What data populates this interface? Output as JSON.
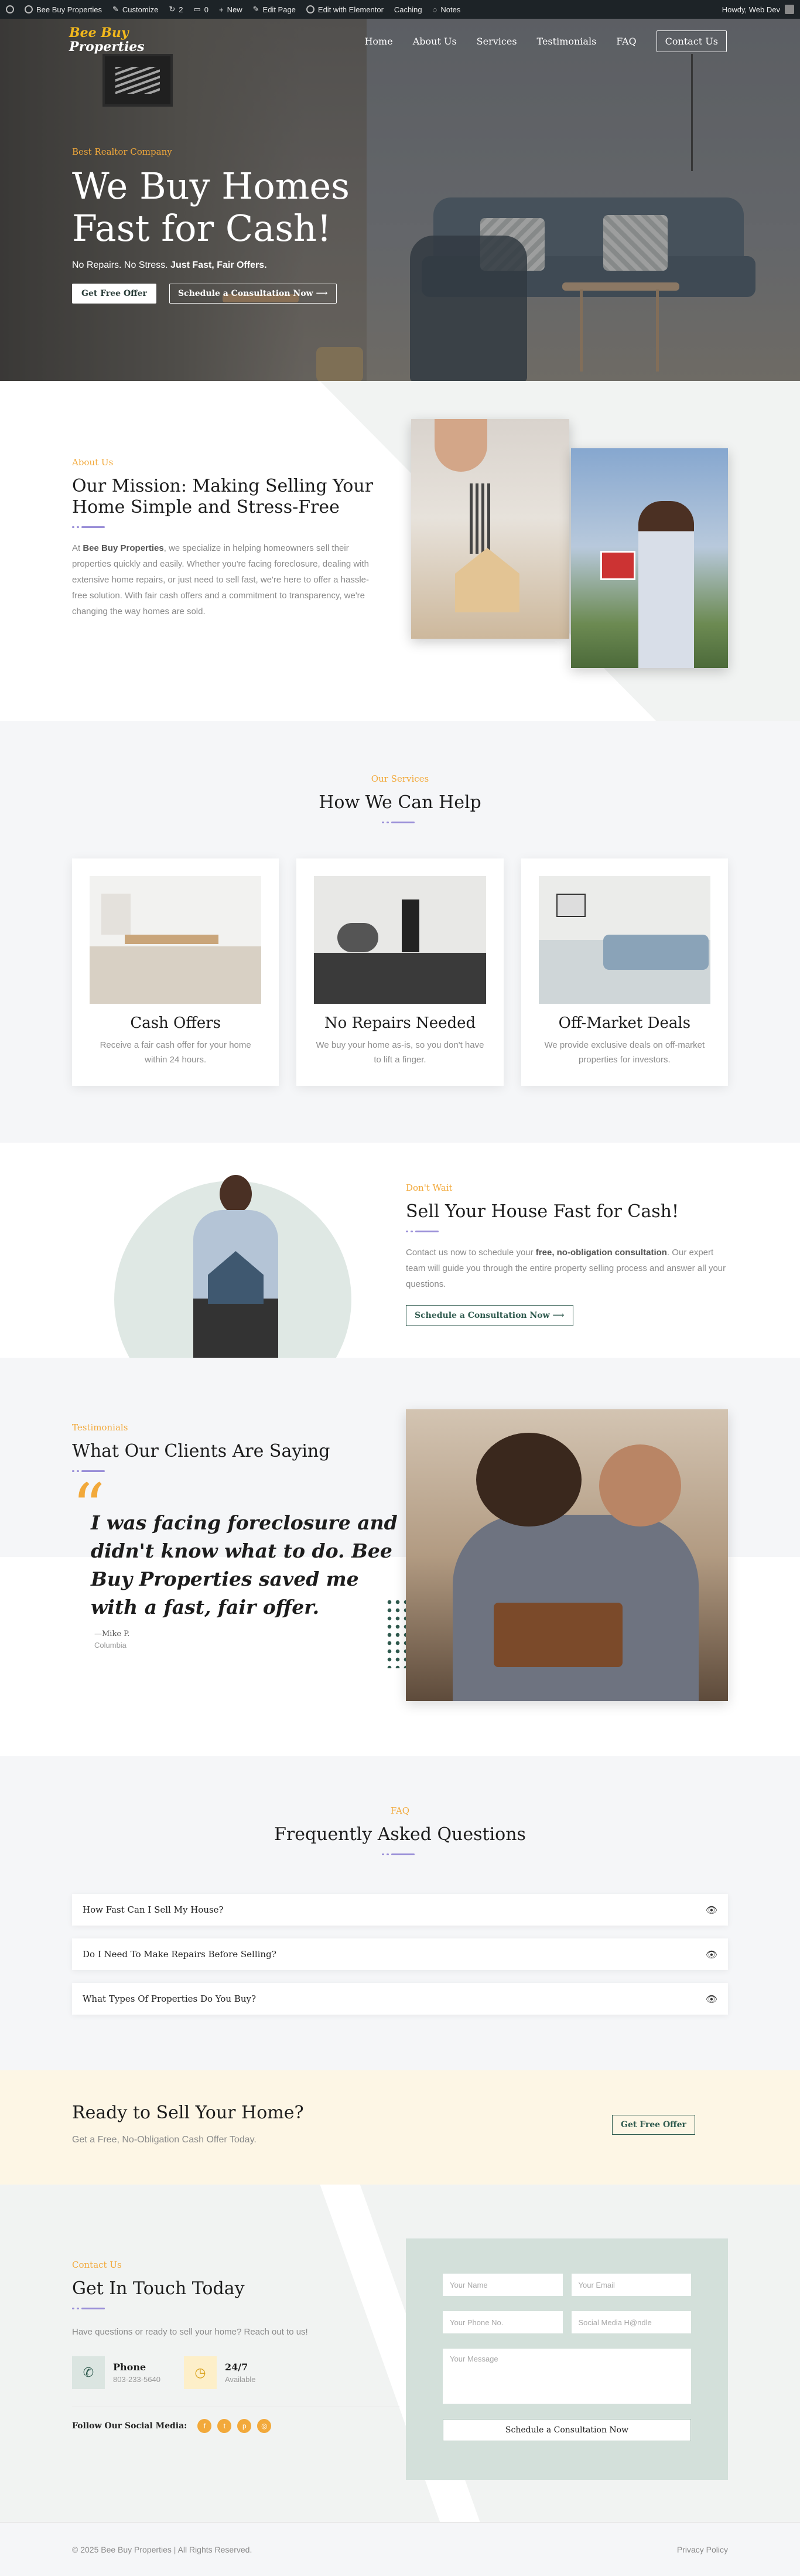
{
  "adminbar": {
    "items": [
      "Bee Buy Properties",
      "Customize",
      "2",
      "0",
      "New",
      "Edit Page",
      "Edit with Elementor",
      "Caching",
      "Notes"
    ],
    "howdy": "Howdy, Web Dev"
  },
  "nav": {
    "logo_line1": "Bee Buy",
    "logo_line2": "Properties",
    "links": [
      "Home",
      "About Us",
      "Services",
      "Testimonials",
      "FAQ"
    ],
    "cta": "Contact Us"
  },
  "hero": {
    "eyebrow": "Best Realtor Company",
    "title_line1": "We Buy Homes",
    "title_line2": "Fast for Cash!",
    "sub_plain": "No Repairs. No Stress.",
    "sub_bold": "Just Fast, Fair Offers.",
    "btn1": "Get Free Offer",
    "btn2": "Schedule a Consultation Now ⟶"
  },
  "about": {
    "eyebrow": "About Us",
    "title": "Our Mission: Making Selling Your Home Simple and Stress-Free",
    "para_prefix": "At ",
    "para_bold": "Bee Buy Properties",
    "para_rest": ", we specialize in helping homeowners sell their properties quickly and easily. Whether you're facing foreclosure, dealing with extensive home repairs, or just need to sell fast, we're here to offer a hassle-free solution. With fair cash offers and a commitment to transparency, we're changing the way homes are sold."
  },
  "services": {
    "eyebrow": "Our Services",
    "title": "How We Can Help",
    "cards": [
      {
        "title": "Cash Offers",
        "text": "Receive a fair cash offer for your home within 24 hours."
      },
      {
        "title": "No Repairs Needed",
        "text": "We buy your home as-is, so you don't have to lift a finger."
      },
      {
        "title": "Off-Market Deals",
        "text": "We provide exclusive deals on off-market properties for investors."
      }
    ]
  },
  "sell": {
    "eyebrow": "Don't Wait",
    "title": "Sell Your House Fast for Cash!",
    "para_prefix": "Contact us now to schedule your ",
    "para_bold": "free, no-obligation consultation",
    "para_rest": ". Our expert team will guide you through the entire property selling process and answer all your questions.",
    "btn": "Schedule a Consultation Now ⟶"
  },
  "testimonials": {
    "eyebrow": "Testimonials",
    "title": "What Our Clients Are Saying",
    "quote": "I was facing foreclosure and didn't know what to do. Bee Buy Properties saved me with a fast, fair offer.",
    "author": "—Mike P.",
    "location": "Columbia"
  },
  "faq": {
    "eyebrow": "FAQ",
    "title": "Frequently Asked Questions",
    "items": [
      "How Fast Can I Sell My House?",
      "Do I Need To Make Repairs Before Selling?",
      "What Types Of Properties Do You Buy?"
    ]
  },
  "ready": {
    "title": "Ready to Sell Your Home?",
    "sub": "Get a Free, No-Obligation Cash Offer Today.",
    "btn": "Get Free Offer"
  },
  "contact": {
    "eyebrow": "Contact Us",
    "title": "Get In Touch Today",
    "sub": "Have questions or ready to sell your home? Reach out to us!",
    "phone_label": "Phone",
    "phone_value": "803-233-5640",
    "hours_label": "24/7",
    "hours_value": "Available",
    "social_label": "Follow Our Social Media:",
    "form": {
      "name": "Your Name",
      "email": "Your Email",
      "phone": "Your Phone No.",
      "handle": "Social Media H@ndle",
      "message": "Your Message",
      "submit": "Schedule a Consultation Now"
    }
  },
  "footer": {
    "copyright": "© 2025 Bee Buy Properties | All Rights Reserved.",
    "privacy": "Privacy Policy"
  },
  "colors": {
    "accent": "#f2a93b",
    "brand_green": "#2f5a4e",
    "dash": "#9a8fd8"
  }
}
